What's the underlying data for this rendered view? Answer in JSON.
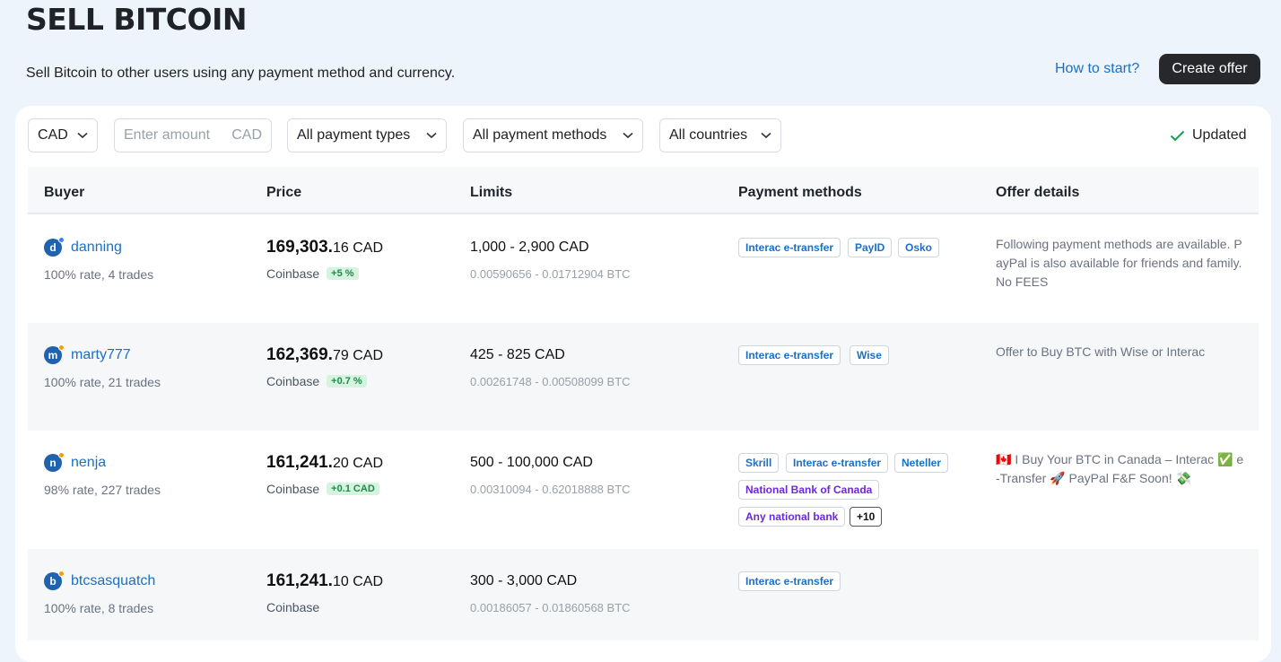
{
  "page": {
    "title": "SELL BITCOIN",
    "subtitle": "Sell Bitcoin to other users using any payment method and currency.",
    "how_to_start": "How to start?",
    "create_offer": "Create offer"
  },
  "filters": {
    "currency": "CAD",
    "amount_placeholder": "Enter amount",
    "amount_currency": "CAD",
    "payment_types": "All payment types",
    "payment_methods": "All payment methods",
    "countries": "All countries",
    "updated": "Updated"
  },
  "columns": {
    "buyer": "Buyer",
    "price": "Price",
    "limits": "Limits",
    "payment_methods": "Payment methods",
    "offer_details": "Offer details"
  },
  "offers": [
    {
      "initial": "d",
      "online_color": "#3b82f6",
      "username": "danning",
      "stats": "100% rate, 4 trades",
      "price_main": "169,303.",
      "price_decimals": "16",
      "price_currency": "CAD",
      "source": "Coinbase",
      "margin": "+5 %",
      "limits": "1,000 - 2,900 CAD",
      "btc_range": "0.00590656 - 0.01712904 BTC",
      "methods": [
        "Interac e-transfer",
        "PayID",
        "Osko"
      ],
      "details": "Following payment methods are available. PayPal is also available for friends and family. No FEES"
    },
    {
      "initial": "m",
      "online_color": "#f59e0b",
      "username": "marty777",
      "stats": "100% rate, 21 trades",
      "price_main": "162,369.",
      "price_decimals": "79",
      "price_currency": "CAD",
      "source": "Coinbase",
      "margin": "+0.7 %",
      "limits": "425 - 825 CAD",
      "btc_range": "0.00261748 - 0.00508099 BTC",
      "methods": [
        "Interac e-transfer",
        "Wise"
      ],
      "details": "Offer to Buy BTC with Wise or Interac"
    },
    {
      "initial": "n",
      "online_color": "#f59e0b",
      "username": "nenja",
      "stats": "98% rate, 227 trades",
      "price_main": "161,241.",
      "price_decimals": "20",
      "price_currency": "CAD",
      "source": "Coinbase",
      "margin": "+0.1 CAD",
      "limits": "500 - 100,000 CAD",
      "btc_range": "0.00310094 - 0.62018888 BTC",
      "methods": [
        "Skrill",
        "Interac e-transfer",
        "Neteller",
        "National Bank of Canada",
        "Any national bank",
        "+10"
      ],
      "details": "🇨🇦 I Buy Your BTC in Canada – Interac ✅ e-Transfer 🚀 PayPal F&F Soon! 💸"
    },
    {
      "initial": "b",
      "online_color": "#f59e0b",
      "username": "btcsasquatch",
      "stats": "100% rate, 8 trades",
      "price_main": "161,241.",
      "price_decimals": "10",
      "price_currency": "CAD",
      "source": "Coinbase",
      "margin": "",
      "limits": "300 - 3,000 CAD",
      "btc_range": "0.00186057 - 0.01860568 BTC",
      "methods": [
        "Interac e-transfer"
      ],
      "details": ""
    }
  ]
}
